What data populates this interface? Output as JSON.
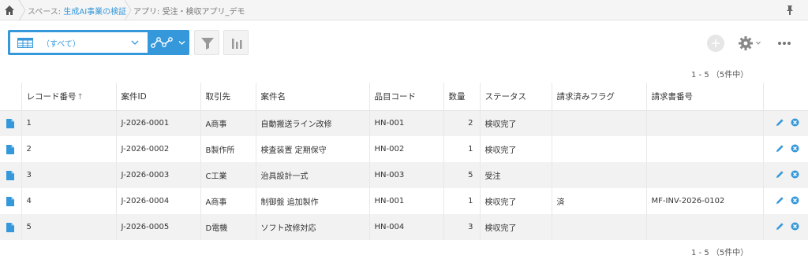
{
  "breadcrumb": {
    "space_prefix": "スペース: ",
    "space_name": "生成AI事業の検証",
    "app_prefix": "アプリ: ",
    "app_name": "受注・検収アプリ_デモ"
  },
  "toolbar": {
    "view_label": "（すべて）"
  },
  "pager": {
    "top": "1 - 5 （5件中）",
    "bottom": "1 - 5 （5件中）"
  },
  "table": {
    "sort_arrow": "↑",
    "columns": [
      "レコード番号",
      "案件ID",
      "取引先",
      "案件名",
      "品目コード",
      "数量",
      "ステータス",
      "請求済みフラグ",
      "請求書番号"
    ],
    "rows": [
      {
        "no": "1",
        "id": "J-2026-0001",
        "client": "A商事",
        "name": "自動搬送ライン改修",
        "item": "HN-001",
        "qty": "2",
        "status": "検収完了",
        "flag": "",
        "invoice": ""
      },
      {
        "no": "2",
        "id": "J-2026-0002",
        "client": "B製作所",
        "name": "検査装置 定期保守",
        "item": "HN-002",
        "qty": "1",
        "status": "検収完了",
        "flag": "",
        "invoice": ""
      },
      {
        "no": "3",
        "id": "J-2026-0003",
        "client": "C工業",
        "name": "治具設計一式",
        "item": "HN-003",
        "qty": "5",
        "status": "受注",
        "flag": "",
        "invoice": ""
      },
      {
        "no": "4",
        "id": "J-2026-0004",
        "client": "A商事",
        "name": "制御盤 追加製作",
        "item": "HN-001",
        "qty": "1",
        "status": "検収完了",
        "flag": "済",
        "invoice": "MF-INV-2026-0102"
      },
      {
        "no": "5",
        "id": "J-2026-0005",
        "client": "D電機",
        "name": "ソフト改修対応",
        "item": "HN-004",
        "qty": "3",
        "status": "検収完了",
        "flag": "",
        "invoice": ""
      }
    ]
  },
  "colors": {
    "accent": "#3498db",
    "row_stripe": "#f2f2f2",
    "delete_icon": "#3498db"
  },
  "icons": {
    "home": "home-icon",
    "pin": "pin-icon",
    "view": "table-icon",
    "graph": "graph-icon",
    "filter": "filter-icon",
    "chart": "bar-chart-icon",
    "add": "plus-icon",
    "settings": "gear-icon",
    "more": "more-icon",
    "record": "document-icon",
    "edit": "pencil-icon",
    "delete": "delete-icon"
  }
}
